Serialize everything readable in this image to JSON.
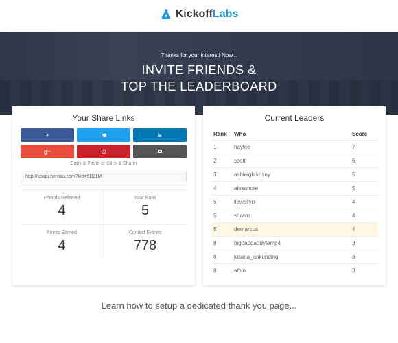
{
  "logo": {
    "brand1": "Kickoff",
    "brand2": "Labs"
  },
  "hero": {
    "pretitle": "Thanks for your interest! Now...",
    "line1": "INVITE FRIENDS &",
    "line2": "TOP THE LEADERBOARD"
  },
  "share": {
    "title": "Your Share Links",
    "copy_label": "Copy & Paste or Click & Share!",
    "url": "http://koapi.heroku.com?kid=5D2HA",
    "buttons": {
      "fb": "facebook",
      "tw": "twitter",
      "li": "linkedin",
      "gp": "google-plus",
      "pi": "pinterest",
      "em": "email"
    },
    "stats": {
      "referred": {
        "label": "Friends Referred",
        "value": "4"
      },
      "rank": {
        "label": "Your Rank",
        "value": "5"
      },
      "points": {
        "label": "Points Earned",
        "value": "4"
      },
      "entries": {
        "label": "Contest Entries",
        "value": "778"
      }
    }
  },
  "leaders": {
    "title": "Current Leaders",
    "headers": {
      "rank": "Rank",
      "who": "Who",
      "score": "Score"
    },
    "rows": [
      {
        "rank": "1",
        "who": "haylee",
        "score": "7"
      },
      {
        "rank": "2",
        "who": "scott",
        "score": "6"
      },
      {
        "rank": "3",
        "who": "ashleigh.kozey",
        "score": "5"
      },
      {
        "rank": "4",
        "who": "alexandre",
        "score": "5"
      },
      {
        "rank": "5",
        "who": "llewellyn",
        "score": "4"
      },
      {
        "rank": "5",
        "who": "shawn",
        "score": "4"
      },
      {
        "rank": "5",
        "who": "demarcus",
        "score": "4",
        "hl": true
      },
      {
        "rank": "8",
        "who": "bigbaddaddytemp4",
        "score": "3"
      },
      {
        "rank": "8",
        "who": "juliana_ankunding",
        "score": "3"
      },
      {
        "rank": "8",
        "who": "albin",
        "score": "3"
      }
    ]
  },
  "footer": "Learn how to setup a dedicated thank you page..."
}
